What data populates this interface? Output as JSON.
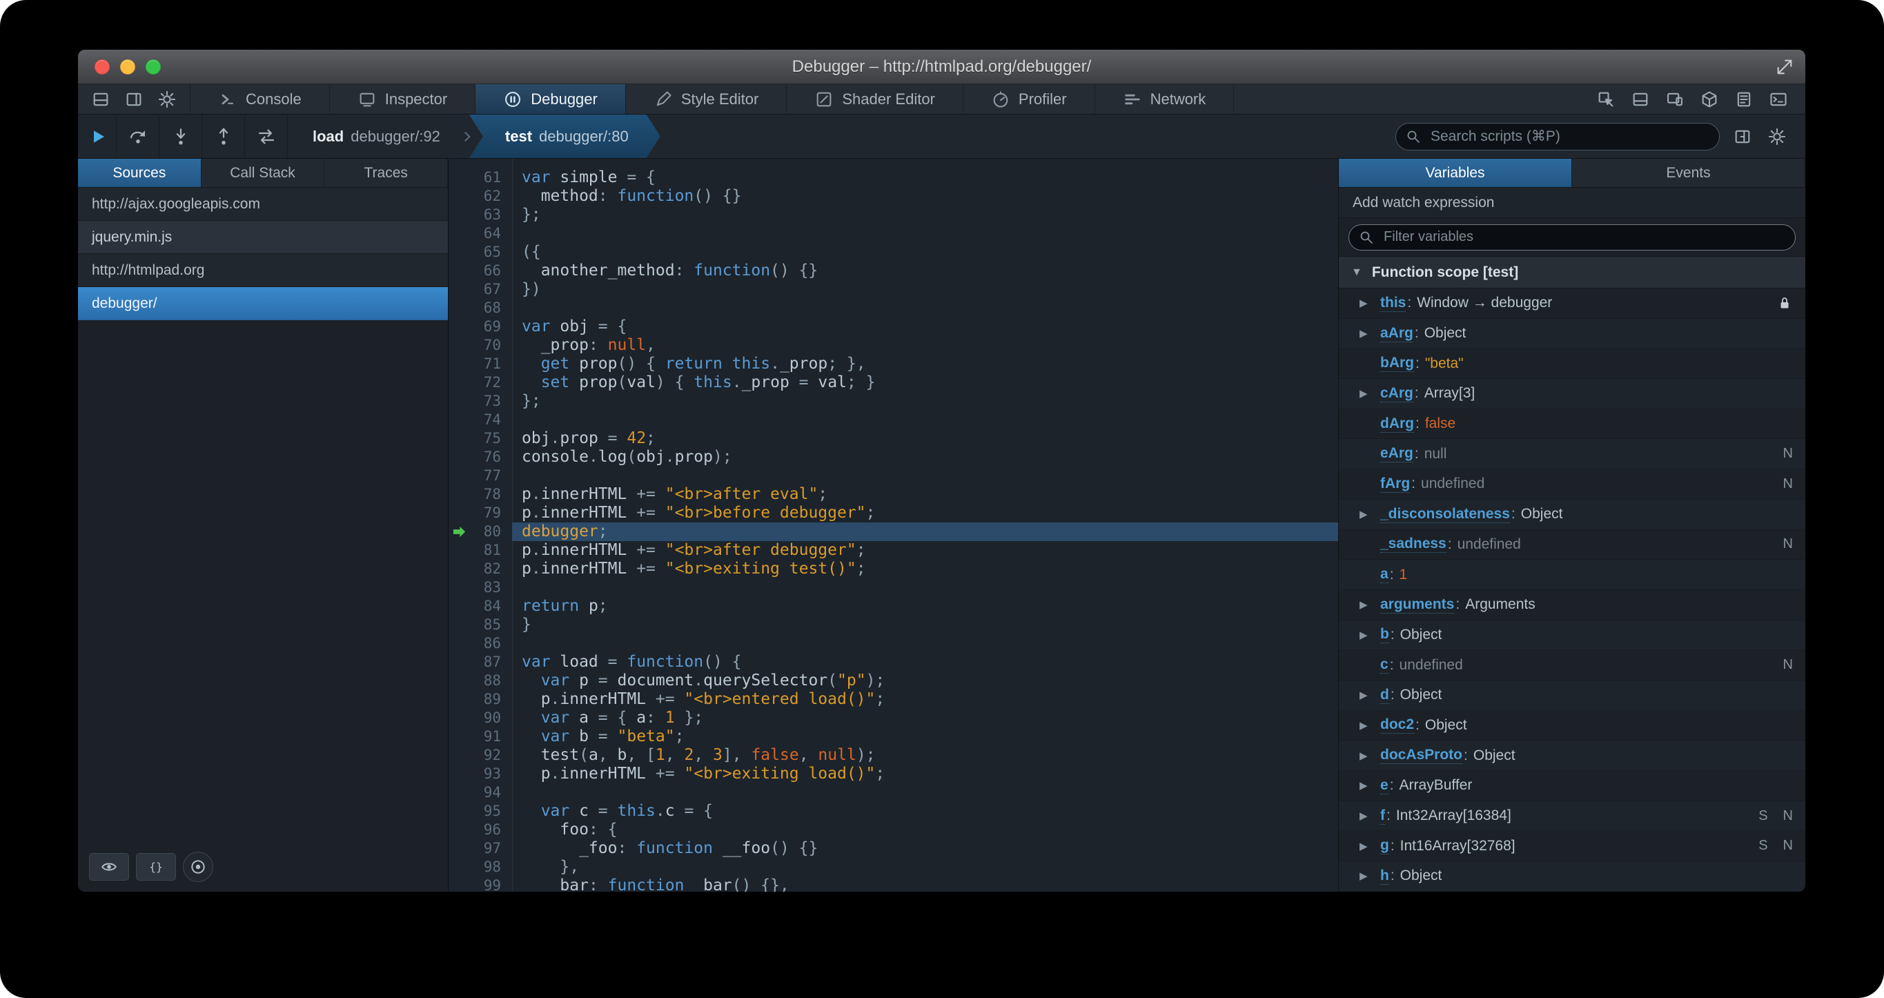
{
  "window": {
    "title": "Debugger – http://htmlpad.org/debugger/"
  },
  "tabbar": {
    "left_icons": [
      "dock-panel-icon",
      "sidebar-toggle-icon",
      "settings-gear-icon"
    ],
    "tabs": [
      {
        "label": "Console",
        "icon": "console-icon",
        "active": false
      },
      {
        "label": "Inspector",
        "icon": "inspector-icon",
        "active": false
      },
      {
        "label": "Debugger",
        "icon": "debugger-icon",
        "active": true
      },
      {
        "label": "Style Editor",
        "icon": "style-editor-icon",
        "active": false
      },
      {
        "label": "Shader Editor",
        "icon": "shader-editor-icon",
        "active": false
      },
      {
        "label": "Profiler",
        "icon": "profiler-icon",
        "active": false
      },
      {
        "label": "Network",
        "icon": "network-icon",
        "active": false
      }
    ],
    "right_icons": [
      "pick-element-icon",
      "split-console-icon",
      "responsive-design-icon",
      "tilt-3d-icon",
      "scratchpad-icon",
      "command-line-icon"
    ]
  },
  "debug_toolbar": {
    "buttons": [
      {
        "icon": "resume-icon",
        "name": "resume-button"
      },
      {
        "icon": "step-over-icon",
        "name": "step-over-button"
      },
      {
        "icon": "step-in-icon",
        "name": "step-in-button"
      },
      {
        "icon": "step-out-icon",
        "name": "step-out-button"
      },
      {
        "icon": "trace-icon",
        "name": "trace-button"
      }
    ],
    "crumbs": [
      {
        "keyword": "load",
        "location": "debugger/:92",
        "active": false
      },
      {
        "keyword": "test",
        "location": "debugger/:80",
        "active": true
      }
    ],
    "search_placeholder": "Search scripts (⌘P)",
    "right_icons": [
      "toggle-panes-icon",
      "debugger-options-gear-icon"
    ]
  },
  "sources_panel": {
    "tabs": [
      {
        "label": "Sources",
        "active": true
      },
      {
        "label": "Call Stack",
        "active": false
      },
      {
        "label": "Traces",
        "active": false
      }
    ],
    "items": [
      {
        "label": "http://ajax.googleapis.com",
        "kind": "domain",
        "selected": false
      },
      {
        "label": "jquery.min.js",
        "kind": "file",
        "selected": false
      },
      {
        "label": "http://htmlpad.org",
        "kind": "domain",
        "selected": false
      },
      {
        "label": "debugger/",
        "kind": "file",
        "selected": true
      }
    ],
    "bottom_icons": [
      "blackbox-eye-icon",
      "pretty-print-icon",
      "pause-exceptions-icon"
    ]
  },
  "editor": {
    "first_line": 61,
    "current_line": 80,
    "lines": [
      [
        [
          "k",
          "var"
        ],
        [
          "i",
          " simple"
        ],
        [
          "p",
          " = {"
        ]
      ],
      [
        [
          "i",
          "  method"
        ],
        [
          "p",
          ":"
        ],
        [
          "k",
          " function"
        ],
        [
          "p",
          "() {}"
        ]
      ],
      [
        [
          "p",
          "};"
        ]
      ],
      [],
      [
        [
          "p",
          "({"
        ]
      ],
      [
        [
          "i",
          "  another_method"
        ],
        [
          "p",
          ":"
        ],
        [
          "k",
          " function"
        ],
        [
          "p",
          "() {}"
        ]
      ],
      [
        [
          "p",
          "})"
        ]
      ],
      [],
      [
        [
          "k",
          "var"
        ],
        [
          "i",
          " obj"
        ],
        [
          "p",
          " = {"
        ]
      ],
      [
        [
          "i",
          "  _prop"
        ],
        [
          "p",
          ":"
        ],
        [
          "a",
          " null"
        ],
        [
          "p",
          ","
        ]
      ],
      [
        [
          "k",
          "  get"
        ],
        [
          "i",
          " prop"
        ],
        [
          "p",
          "() {"
        ],
        [
          "k",
          " return"
        ],
        [
          "k",
          " this"
        ],
        [
          "p",
          "."
        ],
        [
          "i",
          "_prop"
        ],
        [
          "p",
          "; },"
        ]
      ],
      [
        [
          "k",
          "  set"
        ],
        [
          "i",
          " prop"
        ],
        [
          "p",
          "("
        ],
        [
          "i",
          "val"
        ],
        [
          "p",
          ") {"
        ],
        [
          "k",
          " this"
        ],
        [
          "p",
          "."
        ],
        [
          "i",
          "_prop"
        ],
        [
          "p",
          " ="
        ],
        [
          "i",
          " val"
        ],
        [
          "p",
          "; }"
        ]
      ],
      [
        [
          "p",
          "};"
        ]
      ],
      [],
      [
        [
          "i",
          "obj"
        ],
        [
          "p",
          "."
        ],
        [
          "i",
          "prop"
        ],
        [
          "p",
          " ="
        ],
        [
          "n",
          " 42"
        ],
        [
          "p",
          ";"
        ]
      ],
      [
        [
          "i",
          "console"
        ],
        [
          "p",
          "."
        ],
        [
          "i",
          "log"
        ],
        [
          "p",
          "("
        ],
        [
          "i",
          "obj"
        ],
        [
          "p",
          "."
        ],
        [
          "i",
          "prop"
        ],
        [
          "p",
          ");"
        ]
      ],
      [],
      [
        [
          "i",
          "p"
        ],
        [
          "p",
          "."
        ],
        [
          "i",
          "innerHTML"
        ],
        [
          "p",
          " +="
        ],
        [
          "s",
          " \"<br>after eval\""
        ],
        [
          "p",
          ";"
        ]
      ],
      [
        [
          "i",
          "p"
        ],
        [
          "p",
          "."
        ],
        [
          "i",
          "innerHTML"
        ],
        [
          "p",
          " +="
        ],
        [
          "s",
          " \"<br>before debugger\""
        ],
        [
          "p",
          ";"
        ]
      ],
      [
        [
          "d",
          "debugger"
        ],
        [
          "p",
          ";"
        ]
      ],
      [
        [
          "i",
          "p"
        ],
        [
          "p",
          "."
        ],
        [
          "i",
          "innerHTML"
        ],
        [
          "p",
          " +="
        ],
        [
          "s",
          " \"<br>after debugger\""
        ],
        [
          "p",
          ";"
        ]
      ],
      [
        [
          "i",
          "p"
        ],
        [
          "p",
          "."
        ],
        [
          "i",
          "innerHTML"
        ],
        [
          "p",
          " +="
        ],
        [
          "s",
          " \"<br>exiting test()\""
        ],
        [
          "p",
          ";"
        ]
      ],
      [],
      [
        [
          "k",
          "return"
        ],
        [
          "i",
          " p"
        ],
        [
          "p",
          ";"
        ]
      ],
      [
        [
          "p",
          "}"
        ]
      ],
      [],
      [
        [
          "k",
          "var"
        ],
        [
          "i",
          " load"
        ],
        [
          "p",
          " ="
        ],
        [
          "k",
          " function"
        ],
        [
          "p",
          "() {"
        ]
      ],
      [
        [
          "k",
          "  var"
        ],
        [
          "i",
          " p"
        ],
        [
          "p",
          " ="
        ],
        [
          "i",
          " document"
        ],
        [
          "p",
          "."
        ],
        [
          "i",
          "querySelector"
        ],
        [
          "p",
          "("
        ],
        [
          "s",
          "\"p\""
        ],
        [
          "p",
          ");"
        ]
      ],
      [
        [
          "i",
          "  p"
        ],
        [
          "p",
          "."
        ],
        [
          "i",
          "innerHTML"
        ],
        [
          "p",
          " +="
        ],
        [
          "s",
          " \"<br>entered load()\""
        ],
        [
          "p",
          ";"
        ]
      ],
      [
        [
          "k",
          "  var"
        ],
        [
          "i",
          " a"
        ],
        [
          "p",
          " = {"
        ],
        [
          "i",
          " a"
        ],
        [
          "p",
          ":"
        ],
        [
          "n",
          " 1"
        ],
        [
          "p",
          " };"
        ]
      ],
      [
        [
          "k",
          "  var"
        ],
        [
          "i",
          " b"
        ],
        [
          "p",
          " ="
        ],
        [
          "s",
          " \"beta\""
        ],
        [
          "p",
          ";"
        ]
      ],
      [
        [
          "i",
          "  test"
        ],
        [
          "p",
          "("
        ],
        [
          "i",
          "a"
        ],
        [
          "p",
          ","
        ],
        [
          "i",
          " b"
        ],
        [
          "p",
          ", ["
        ],
        [
          "n",
          "1"
        ],
        [
          "p",
          ","
        ],
        [
          "n",
          " 2"
        ],
        [
          "p",
          ","
        ],
        [
          "n",
          " 3"
        ],
        [
          "p",
          "],"
        ],
        [
          "a",
          " false"
        ],
        [
          "p",
          ","
        ],
        [
          "a",
          " null"
        ],
        [
          "p",
          ");"
        ]
      ],
      [
        [
          "i",
          "  p"
        ],
        [
          "p",
          "."
        ],
        [
          "i",
          "innerHTML"
        ],
        [
          "p",
          " +="
        ],
        [
          "s",
          " \"<br>exiting load()\""
        ],
        [
          "p",
          ";"
        ]
      ],
      [],
      [
        [
          "k",
          "  var"
        ],
        [
          "i",
          " c"
        ],
        [
          "p",
          " ="
        ],
        [
          "k",
          " this"
        ],
        [
          "p",
          "."
        ],
        [
          "i",
          "c"
        ],
        [
          "p",
          " = {"
        ]
      ],
      [
        [
          "i",
          "    foo"
        ],
        [
          "p",
          ": {"
        ]
      ],
      [
        [
          "i",
          "      _foo"
        ],
        [
          "p",
          ":"
        ],
        [
          "k",
          " function"
        ],
        [
          "i",
          " __foo"
        ],
        [
          "p",
          "() {}"
        ]
      ],
      [
        [
          "p",
          "    },"
        ]
      ],
      [
        [
          "i",
          "    bar"
        ],
        [
          "p",
          ":"
        ],
        [
          "k",
          " function"
        ],
        [
          "i",
          " _bar"
        ],
        [
          "p",
          "() {},"
        ]
      ]
    ]
  },
  "variables_panel": {
    "tabs": [
      {
        "label": "Variables",
        "active": true
      },
      {
        "label": "Events",
        "active": false
      }
    ],
    "watch_label": "Add watch expression",
    "filter_placeholder": "Filter variables",
    "scope_label": "Function scope [test]",
    "variables": [
      {
        "name": "this",
        "value": "Window → debugger",
        "vtype": "plain",
        "arrow": true,
        "lock": true
      },
      {
        "name": "aArg",
        "value": "Object",
        "vtype": "plain",
        "arrow": true
      },
      {
        "name": "bArg",
        "value": "\"beta\"",
        "vtype": "string"
      },
      {
        "name": "cArg",
        "value": "Array[3]",
        "vtype": "plain",
        "arrow": true
      },
      {
        "name": "dArg",
        "value": "false",
        "vtype": "bool"
      },
      {
        "name": "eArg",
        "value": "null",
        "vtype": "null",
        "badges": [
          "N"
        ]
      },
      {
        "name": "fArg",
        "value": "undefined",
        "vtype": "undefined",
        "badges": [
          "N"
        ]
      },
      {
        "name": "_disconsolateness",
        "value": "Object",
        "vtype": "plain",
        "arrow": true
      },
      {
        "name": "_sadness",
        "value": "undefined",
        "vtype": "undefined",
        "badges": [
          "N"
        ]
      },
      {
        "name": "a",
        "value": "1",
        "vtype": "number"
      },
      {
        "name": "arguments",
        "value": "Arguments",
        "vtype": "plain",
        "arrow": true
      },
      {
        "name": "b",
        "value": "Object",
        "vtype": "plain",
        "arrow": true
      },
      {
        "name": "c",
        "value": "undefined",
        "vtype": "undefined",
        "badges": [
          "N"
        ]
      },
      {
        "name": "d",
        "value": "Object",
        "vtype": "plain",
        "arrow": true
      },
      {
        "name": "doc2",
        "value": "Object",
        "vtype": "plain",
        "arrow": true
      },
      {
        "name": "docAsProto",
        "value": "Object",
        "vtype": "plain",
        "arrow": true
      },
      {
        "name": "e",
        "value": "ArrayBuffer",
        "vtype": "plain",
        "arrow": true
      },
      {
        "name": "f",
        "value": "Int32Array[16384]",
        "vtype": "plain",
        "arrow": true,
        "badges": [
          "S",
          "N"
        ]
      },
      {
        "name": "g",
        "value": "Int16Array[32768]",
        "vtype": "plain",
        "arrow": true,
        "badges": [
          "S",
          "N"
        ]
      },
      {
        "name": "h",
        "value": "Object",
        "vtype": "plain",
        "arrow": true
      }
    ]
  }
}
